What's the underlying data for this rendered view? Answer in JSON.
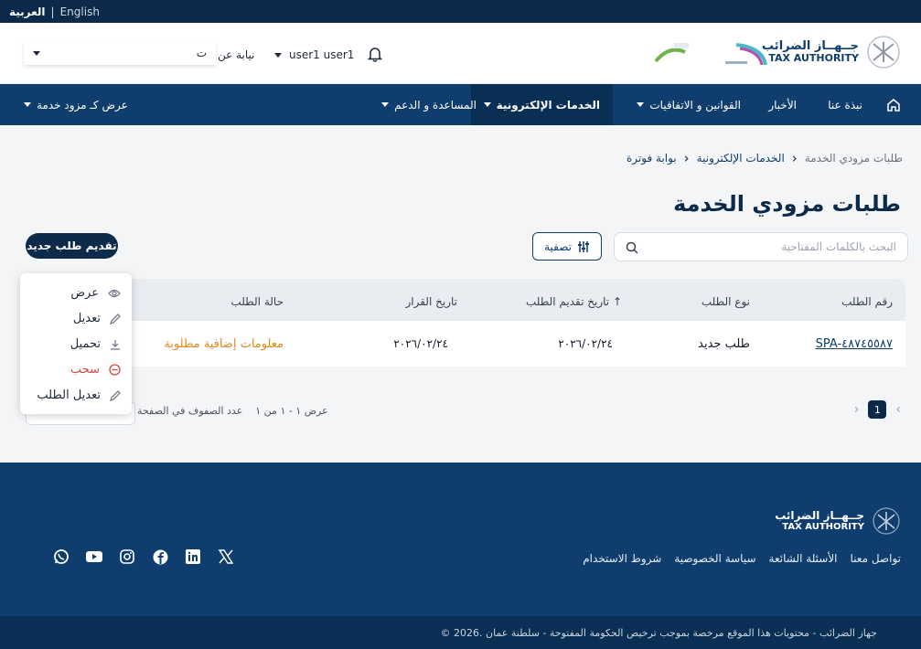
{
  "topbar": {
    "lang_ar": "العربية",
    "separator": "|",
    "lang_en": "English"
  },
  "header": {
    "logo_ar": "جــهــاز الضرائب",
    "logo_en": "TAX AUTHORITY",
    "user_name": "user1 user1",
    "on_behalf_label": "نيابة عن",
    "on_behalf_value": "ت"
  },
  "nav": {
    "home_icon": "home-icon",
    "about": "نبذة عنا",
    "news": "الأخبار",
    "laws": "القوانين و الاتفاقيات",
    "eservices": "الخدمات الإلكترونية",
    "help": "المساعدة و الدعم",
    "view_as": "عرض كـ مزود خدمة"
  },
  "breadcrumb": {
    "item1": "بوابة فوترة",
    "item2": "الخدمات الإلكترونية",
    "item3": "طلبات مزودي الخدمة",
    "sep": "›"
  },
  "page_title": "طلبات مزودي الخدمة",
  "search": {
    "placeholder": "البحث بالكلمات المفتاحية"
  },
  "filter_label": "تصفية",
  "new_request_label": "تقديم طلب جديد",
  "table": {
    "headers": [
      "رقم الطلب",
      "نوع الطلب",
      "تاريخ تقديم الطلب ↑",
      "تاريخ القرار",
      "حالة الطلب"
    ],
    "rows": [
      {
        "request_no": "SPA-٤٨٧٤٥٥٨٧",
        "type": "طلب جديد",
        "submitted": "٢٠٢٦/٠٢/٢٤",
        "decision": "٢٠٢٦/٠٢/٢٤",
        "status": "معلومات إضافية مطلوبة"
      }
    ],
    "status_color": "#e08a1e"
  },
  "actions_menu": {
    "view": "عرض",
    "edit": "تعديل",
    "download": "تحميل",
    "withdraw": "سحب",
    "edit_request": "تعديل الطلب"
  },
  "pagination": {
    "current_page": "1",
    "rows_info": "عرض ١ - ١ من ١",
    "rows_per_page_label": "عدد الصفوف في الصفحة"
  },
  "footer": {
    "logo_ar": "جــهــاز الضرائب",
    "logo_en": "TAX AUTHORITY",
    "links": [
      "شروط الاستخدام",
      "سياسة الخصوصية",
      "الأسئلة الشائعة",
      "تواصل معنا"
    ],
    "copyright": "© 2026. جهاز الضرائب - محتويات هذا الموقع مرخصة بموجب ترخيص الحكومة المفتوحة - سلطنة عمان"
  },
  "colors": {
    "navy": "#0e3d6e",
    "dark_navy": "#0b2a4a",
    "accent_orange": "#e08a1e",
    "danger": "#d64545"
  }
}
